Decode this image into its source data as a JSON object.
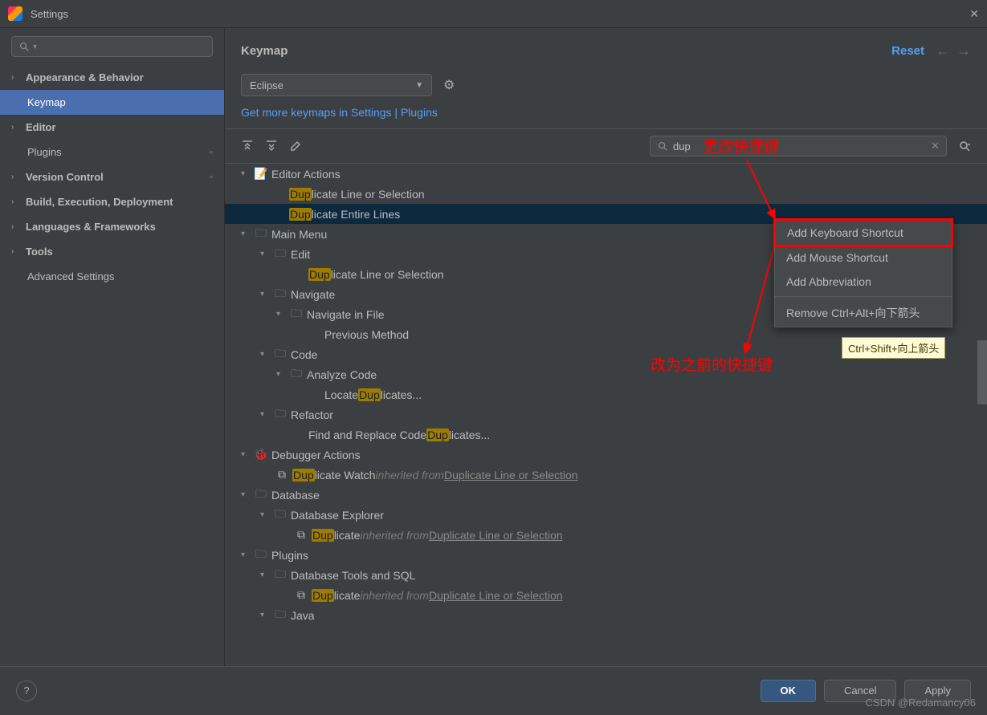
{
  "window": {
    "title": "Settings"
  },
  "sidebar": {
    "search_placeholder": "",
    "items": [
      {
        "label": "Appearance & Behavior",
        "chev": true,
        "bold": true
      },
      {
        "label": "Keymap",
        "selected": true,
        "indent": true
      },
      {
        "label": "Editor",
        "chev": true,
        "bold": true
      },
      {
        "label": "Plugins",
        "squares": true,
        "indent": true
      },
      {
        "label": "Version Control",
        "chev": true,
        "bold": true,
        "squares": true
      },
      {
        "label": "Build, Execution, Deployment",
        "chev": true,
        "bold": true
      },
      {
        "label": "Languages & Frameworks",
        "chev": true,
        "bold": true
      },
      {
        "label": "Tools",
        "chev": true,
        "bold": true
      },
      {
        "label": "Advanced Settings",
        "indent": true
      }
    ]
  },
  "header": {
    "title": "Keymap",
    "reset": "Reset"
  },
  "keymap_select": "Eclipse",
  "more_link": "Get more keymaps in Settings | Plugins",
  "search_value": "dup",
  "tree": {
    "editor_actions": "Editor Actions",
    "dup_line_sel": {
      "pre": "Dup",
      "post": "licate Line or Selection"
    },
    "dup_entire": {
      "pre": "Dup",
      "post": "licate Entire Lines"
    },
    "main_menu": "Main Menu",
    "edit": "Edit",
    "dup_line_sel2": {
      "pre": "Dup",
      "post": "licate Line or Selection"
    },
    "navigate": "Navigate",
    "nav_in_file": "Navigate in File",
    "prev_method": "Previous Method",
    "code": "Code",
    "analyze_code": "Analyze Code",
    "locate_dup": {
      "pre_text": "Locate ",
      "hl": "Dup",
      "post": "licates..."
    },
    "refactor": "Refactor",
    "find_replace": {
      "pre_text": "Find and Replace Code ",
      "hl": "Dup",
      "post": "licates..."
    },
    "debugger_actions": "Debugger Actions",
    "dup_watch": {
      "hl": "Dup",
      "post": "licate Watch",
      "inherited": " inherited from ",
      "link": "Duplicate Line or Selection"
    },
    "database": "Database",
    "db_explorer": "Database Explorer",
    "dup_db": {
      "hl": "Dup",
      "post": "licate",
      "inherited": " inherited from ",
      "link": "Duplicate Line or Selection"
    },
    "plugins": "Plugins",
    "db_tools_sql": "Database Tools and SQL",
    "dup_sql": {
      "hl": "Dup",
      "post": "licate",
      "inherited": " inherited from ",
      "link": "Duplicate Line or Selection"
    },
    "java": "Java"
  },
  "context_menu": {
    "add_kbd": "Add Keyboard Shortcut",
    "add_mouse": "Add Mouse Shortcut",
    "add_abbr": "Add Abbreviation",
    "remove": "Remove Ctrl+Alt+向下箭头"
  },
  "tooltip": "Ctrl+Shift+向上箭头",
  "annotations": {
    "top": "更改快捷键",
    "bottom": "改为之前的快捷键"
  },
  "footer": {
    "ok": "OK",
    "cancel": "Cancel",
    "apply": "Apply"
  },
  "watermark": "CSDN @Redamancy06"
}
